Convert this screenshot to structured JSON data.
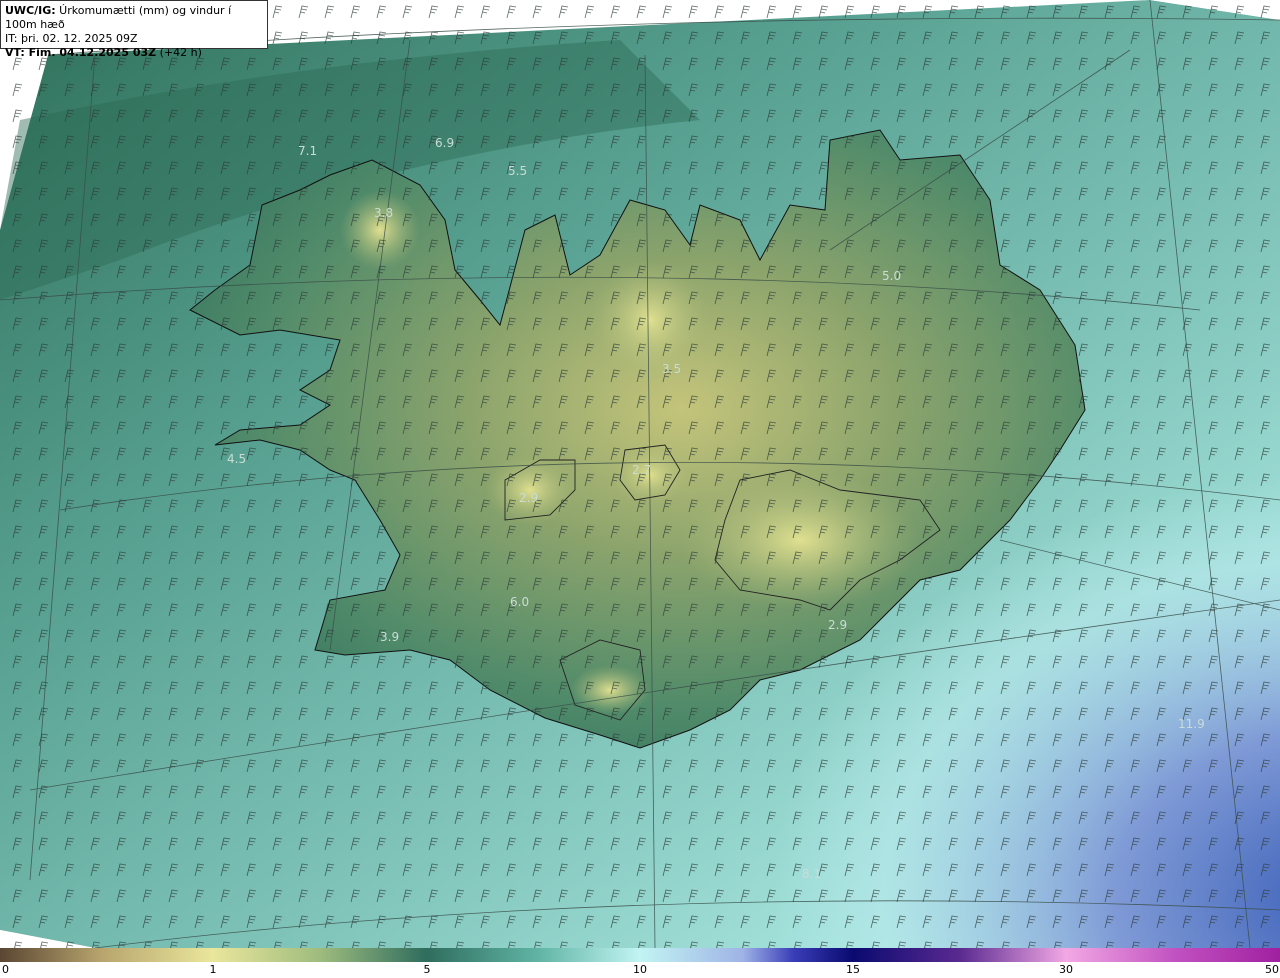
{
  "header": {
    "line1_prefix": "UWC/IG:",
    "line1_text": " Úrkomumætti (mm) og vindur í 100m hæð",
    "line2": "IT: þri. 02. 12. 2025 09Z",
    "line3_prefix": "VT: Fim. 04.12.2025 03Z",
    "line3_suffix": " (+42 h)"
  },
  "map_values": [
    "7.1",
    "6.9",
    "5.5",
    "3.8",
    "5.0",
    "3.5",
    "4.5",
    "2.9",
    "2.7",
    "6.0",
    "3.9",
    "2.9",
    "11.9",
    "8.1"
  ],
  "colorbar": {
    "ticks": [
      "0",
      "1",
      "5",
      "10",
      "15",
      "30",
      "50"
    ],
    "colors": [
      "#5a4632",
      "#c8b47a",
      "#e9e49a",
      "#8fb27a",
      "#2f6d5e",
      "#5fb3a3",
      "#bff3f2",
      "#9fb4e6",
      "#3a3db8",
      "#0a0a70",
      "#6a2a9a",
      "#c06ac0",
      "#f2a0e0",
      "#a020a0"
    ]
  }
}
